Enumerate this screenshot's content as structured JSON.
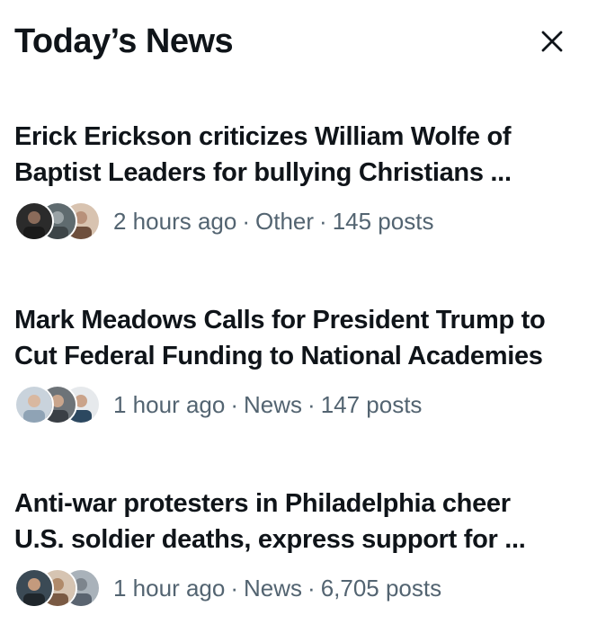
{
  "header": {
    "title": "Today’s News",
    "close_icon": "close-icon"
  },
  "stories": [
    {
      "title_line1": "Erick Erickson criticizes William Wolfe of",
      "title_line2": "Baptist Leaders for bullying Christians ...",
      "time": "2 hours ago",
      "category": "Other",
      "posts": "145 posts",
      "avatars": [
        "#2b2b2b",
        "#5f6b6f",
        "#b8917a"
      ]
    },
    {
      "title_line1": "Mark Meadows Calls for President Trump to",
      "title_line2": "Cut Federal Funding to National Academies",
      "time": "1 hour ago",
      "category": "News",
      "posts": "147 posts",
      "avatars": [
        "#8fa3b5",
        "#3a3f45",
        "#2c4860"
      ]
    },
    {
      "title_line1": "Anti-war protesters in Philadelphia cheer",
      "title_line2": "U.S. soldier deaths, express support for ...",
      "time": "1 hour ago",
      "category": "News",
      "posts": "6,705 posts",
      "avatars": [
        "#3b4a55",
        "#b08a6a",
        "#5a6470"
      ]
    }
  ],
  "separator": "·"
}
